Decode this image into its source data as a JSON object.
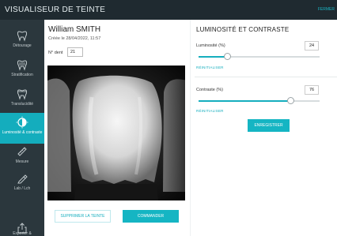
{
  "window": {
    "title": "VISUALISEUR DE TEINTE",
    "close_label": "FERMER"
  },
  "sidebar": {
    "items": [
      {
        "label": "Détourage",
        "icon": "tooth-outline-icon",
        "active": false
      },
      {
        "label": "Stratification",
        "icon": "tooth-layers-icon",
        "active": false
      },
      {
        "label": "Translucidité",
        "icon": "tooth-translucency-icon",
        "active": false
      },
      {
        "label": "Luminosité & contraste",
        "icon": "half-circle-contrast-icon",
        "active": true
      },
      {
        "label": "Mesure",
        "icon": "ruler-icon",
        "active": false
      },
      {
        "label": "Lab / Lch",
        "icon": "color-pick-icon",
        "active": false
      },
      {
        "label": "Exporter &",
        "icon": "export-icon",
        "active": false
      }
    ]
  },
  "patient": {
    "name": "William SMITH",
    "created": "Créée le 28/04/2022, 11:57",
    "tooth_label": "N° dent",
    "tooth_number": "21"
  },
  "actions": {
    "delete_label": "SUPPRIMER LA TEINTE",
    "order_label": "COMMANDER"
  },
  "settings": {
    "title": "LUMINOSITÉ ET CONTRASTE",
    "brightness": {
      "label": "Luminosité (%)",
      "value": "24",
      "reset_label": "RÉINITIALISER",
      "level_percent": 24
    },
    "contrast": {
      "label": "Contraste (%)",
      "value": "76",
      "reset_label": "RÉINITIALISER",
      "level_percent": 76
    },
    "save_label": "ENREGISTRER"
  },
  "colors": {
    "accent": "#15b5c3",
    "sidebar_bg": "#2b373d",
    "titlebar_bg": "#1f2a30"
  }
}
